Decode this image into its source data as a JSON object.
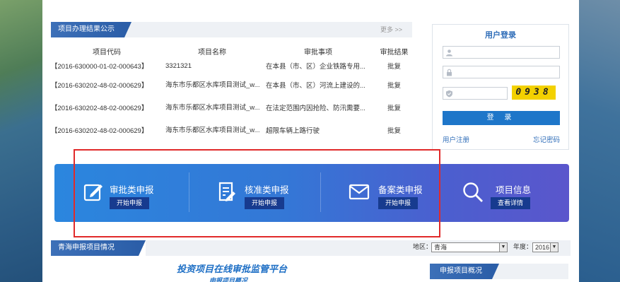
{
  "results": {
    "title": "项目办理结果公示",
    "more": "更多 >>",
    "headers": [
      "项目代码",
      "项目名称",
      "审批事项",
      "审批结果"
    ],
    "rows": [
      {
        "code": "【2016-630000-01-02-000643】",
        "name": "3321321",
        "item": "在本县（市、区）企业铁路专用...",
        "result": "批复"
      },
      {
        "code": "【2016-630202-48-02-000629】",
        "name": "海东市乐都区水库项目测试_w...",
        "item": "在本县（市、区）河流上建设的...",
        "result": "批复"
      },
      {
        "code": "【2016-630202-48-02-000629】",
        "name": "海东市乐都区水库项目测试_w...",
        "item": "在法定范围内因抢险、防汛需要...",
        "result": "批复"
      },
      {
        "code": "【2016-630202-48-02-000629】",
        "name": "海东市乐都区水库项目测试_w...",
        "item": "超限车辆上路行驶",
        "result": "批复"
      }
    ]
  },
  "login": {
    "title": "用户登录",
    "username_placeholder": "",
    "password_placeholder": "",
    "captcha_placeholder": "",
    "captcha_text": "0938",
    "submit": "登 录",
    "register": "用户注册",
    "forgot": "忘记密码"
  },
  "actions": [
    {
      "title": "审批类申报",
      "button": "开始申报",
      "icon": "edit-icon"
    },
    {
      "title": "核准类申报",
      "button": "开始申报",
      "icon": "document-icon"
    },
    {
      "title": "备案类申报",
      "button": "开始申报",
      "icon": "mail-icon"
    },
    {
      "title": "项目信息",
      "button": "查看详情",
      "icon": "search-icon"
    }
  ],
  "status": {
    "title": "青海申报项目情况",
    "region_label": "地区：",
    "region_value": "青海",
    "year_label": "年度：",
    "year_value": "2016",
    "chart_title": "投资项目在线审批监管平台",
    "chart_subtitle": "申报项目概况",
    "overview_title": "申报项目概况"
  },
  "colors": {
    "accent": "#2b5ea8",
    "banner_start": "#2b86de",
    "banner_end": "#5a56cc",
    "highlight_box": "#e12a2a"
  }
}
